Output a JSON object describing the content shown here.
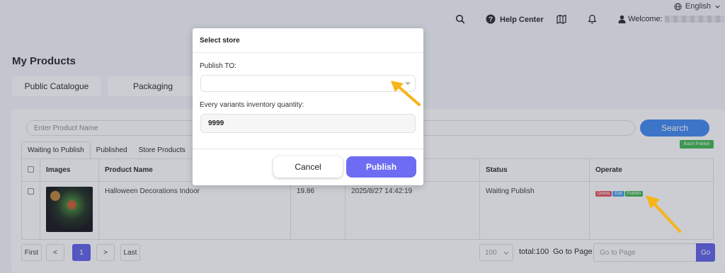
{
  "topbar": {
    "language": "English",
    "help_center": "Help Center",
    "welcome": "Welcome:"
  },
  "page": {
    "title": "My Products",
    "tabs": [
      "Public Catalogue",
      "Packaging"
    ]
  },
  "search": {
    "placeholder": "Enter Product Name",
    "button": "Search",
    "batch_publish": "Batch Publish"
  },
  "subtabs": [
    "Waiting to Publish",
    "Published",
    "Store Products"
  ],
  "table": {
    "headers": [
      "Images",
      "Product Name",
      "Status",
      "Operate"
    ],
    "row": {
      "product_name": "Halloween Decorations Indoor",
      "price": "19.86",
      "date": "2025/8/27 14:42:19",
      "status": "Waiting Publish",
      "ops": [
        "Delete",
        "Edit",
        "Publish"
      ]
    }
  },
  "pagination": {
    "first": "First",
    "prev": "<",
    "current": "1",
    "next": ">",
    "last": "Last",
    "page_size": "100",
    "total": "total:100",
    "goto_label": "Go to Page",
    "goto_placeholder": "Go to Page",
    "go": "Go"
  },
  "modal": {
    "title": "Select store",
    "publish_to_label": "Publish TO:",
    "publish_to_value": "",
    "inventory_label": "Every variants inventory quantity:",
    "inventory_value": "9999",
    "cancel": "Cancel",
    "publish": "Publish"
  },
  "colors": {
    "accent": "#6d6cf2",
    "search_blue": "#3a84f0",
    "arrow": "#f6b418",
    "delete": "#e5505a",
    "edit": "#4a9ee6",
    "publish_green": "#3bb54a"
  }
}
